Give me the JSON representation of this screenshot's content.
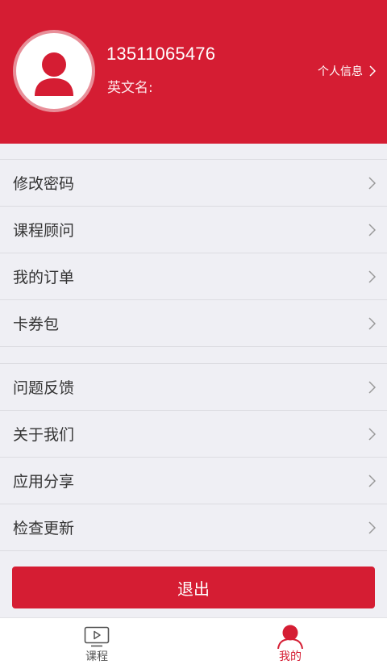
{
  "profile": {
    "phone": "13511065476",
    "english_name_label": "英文名:",
    "english_name_value": "",
    "info_link_label": "个人信息"
  },
  "menu_group_1": [
    {
      "label": "修改密码"
    },
    {
      "label": "课程顾问"
    },
    {
      "label": "我的订单"
    },
    {
      "label": "卡券包"
    }
  ],
  "menu_group_2": [
    {
      "label": "问题反馈"
    },
    {
      "label": "关于我们"
    },
    {
      "label": "应用分享"
    },
    {
      "label": "检查更新"
    }
  ],
  "logout_label": "退出",
  "tabbar": {
    "courses_label": "课程",
    "mine_label": "我的"
  },
  "colors": {
    "brand_red": "#d51d33",
    "background": "#efeff4",
    "inactive_tab": "#555555"
  },
  "icons": {
    "avatar": "user-silhouette-icon",
    "row_chevron": "chevron-right-icon",
    "tab_courses": "video-play-icon",
    "tab_mine": "user-icon"
  }
}
